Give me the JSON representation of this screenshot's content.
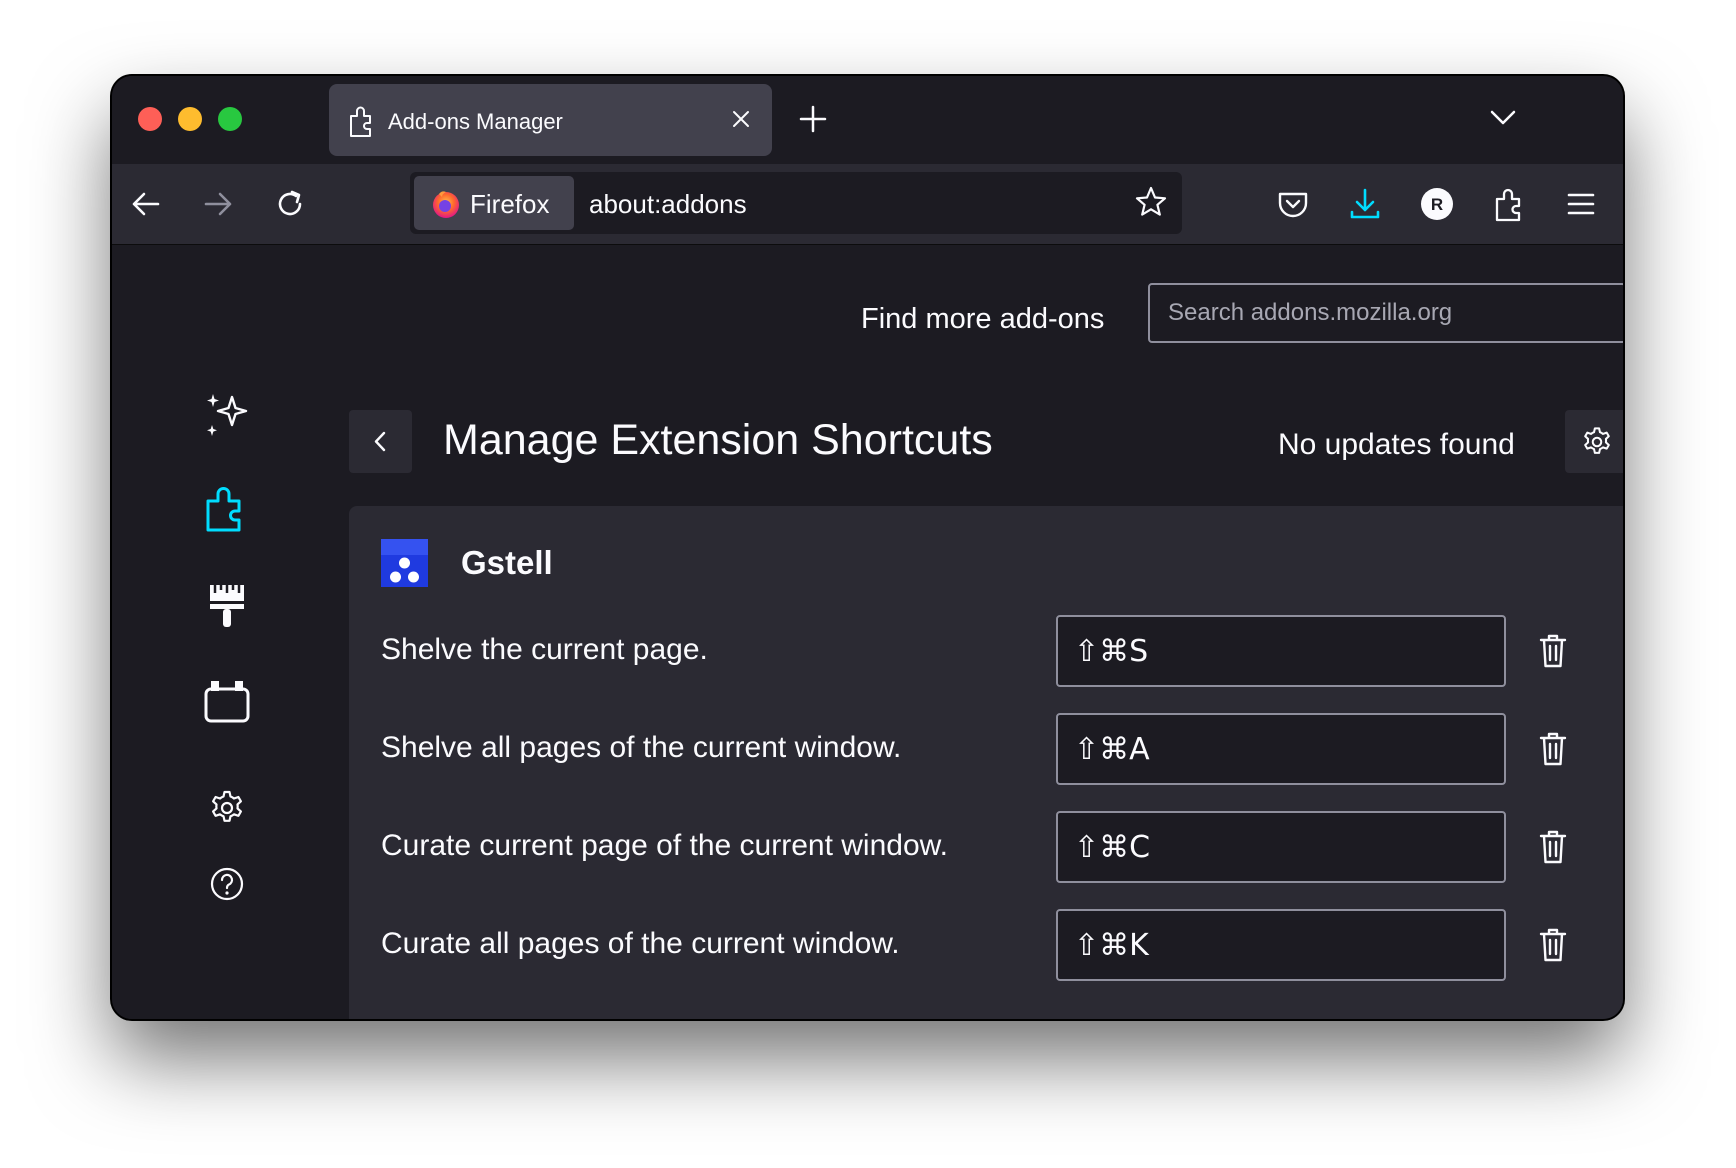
{
  "tab": {
    "title": "Add-ons Manager",
    "icon": "puzzle-icon"
  },
  "urlbar": {
    "identity_label": "Firefox",
    "url": "about:addons"
  },
  "addons_page": {
    "find_more_label": "Find more add-ons",
    "search_placeholder": "Search addons.mozilla.org",
    "title": "Manage Extension Shortcuts",
    "update_status": "No updates found"
  },
  "sidebar": {
    "categories": [
      {
        "name": "recommendations",
        "icon": "sparkle-icon"
      },
      {
        "name": "extensions",
        "icon": "puzzle-icon",
        "selected": true
      },
      {
        "name": "themes",
        "icon": "paintbrush-icon"
      },
      {
        "name": "plugins",
        "icon": "plugin-icon"
      },
      {
        "name": "settings",
        "icon": "gear-icon"
      },
      {
        "name": "help",
        "icon": "help-icon"
      }
    ]
  },
  "extension": {
    "name": "Gstell",
    "shortcuts": [
      {
        "label": "Shelve the current page.",
        "keys": "⇧⌘S"
      },
      {
        "label": "Shelve all pages of the current window.",
        "keys": "⇧⌘A"
      },
      {
        "label": "Curate current page of the current window.",
        "keys": "⇧⌘C"
      },
      {
        "label": "Curate all pages of the current window.",
        "keys": "⇧⌘K"
      }
    ]
  },
  "colors": {
    "accent": "#00ddff",
    "download_accent": "#00ddff",
    "background": "#1c1b22",
    "card": "#2b2a33"
  }
}
